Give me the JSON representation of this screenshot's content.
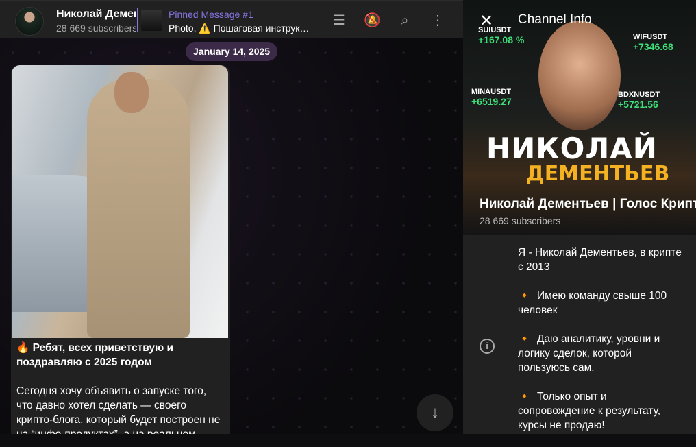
{
  "header": {
    "title": "Николай Дементьев | Голос Крипты",
    "subscribers": "28 669 subscribers",
    "pinned_title": "Pinned Message #1",
    "pinned_text": "Photo, ⚠️ Пошаговая инструк…"
  },
  "chat": {
    "date": "January 14, 2025",
    "message_headline": "🔥 Ребят, всех приветствую и поздравляю с 2025 годом",
    "message_body": "Сегодня хочу объявить о запуске того, что давно хотел сделать — своего крипто-блога, который будет построен не на “инфо-продуктах”, а на реальном"
  },
  "panel": {
    "title": "Channel Info",
    "channel_name": "Николай Дементьев | Голос Крипты",
    "subscribers": "28 669 subscribers",
    "cover_text": {
      "line1": "НИКОЛАЙ",
      "line2": "ДЕМЕНТЬЕВ",
      "tickers": [
        {
          "name": "SUIUSDT",
          "value": "+167.08 %"
        },
        {
          "name": "WIFUSDT",
          "value": "+7346.68"
        },
        {
          "name": "MINAUSDT",
          "value": "+6519.27"
        },
        {
          "name": "BDXNUSDT",
          "value": "+5721.56"
        }
      ]
    },
    "description": [
      "Я - Николай Дементьев, в крипте с 2013",
      "Имею команду свыше 100 человек",
      "Даю аналитику, уровни и логику сделок, которой пользуюсь сам.",
      "Только опыт и сопровождение к результату, курсы не продаю!"
    ],
    "bullet": "🔸"
  },
  "colors": {
    "accent": "#8774e1",
    "panel": "#212121",
    "date_badge": "#3b2a48"
  }
}
